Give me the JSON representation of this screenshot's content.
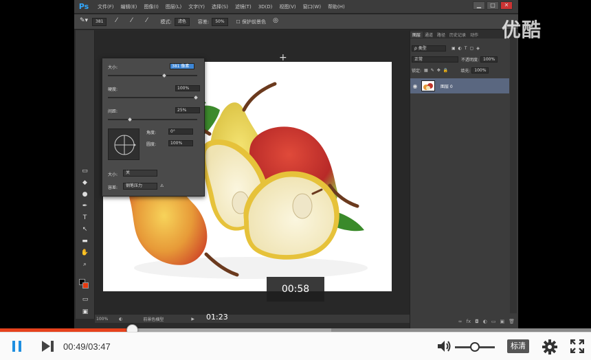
{
  "photoshop": {
    "logo": "Ps",
    "menus": [
      "文件(F)",
      "编辑(E)",
      "图像(I)",
      "图层(L)",
      "文字(Y)",
      "选择(S)",
      "滤镜(T)",
      "3D(D)",
      "视图(V)",
      "窗口(W)",
      "帮助(H)"
    ],
    "window_buttons": [
      "▁",
      "□",
      "✕"
    ],
    "options_bar": {
      "brush_size": "381",
      "mode_label": "模式:",
      "mode_value": "滤色",
      "opacity_label": "容差:",
      "opacity_value": "50%",
      "protect_label": "保护前景色"
    },
    "brush_panel": {
      "size_label": "大小:",
      "size_value": "381 像素",
      "hardness_label": "硬度:",
      "hardness_value": "100%",
      "spacing_label": "间距:",
      "spacing_value": "25%",
      "angle_label": "角度:",
      "angle_value": "0°",
      "roundness_label": "圆度:",
      "roundness_value": "100%",
      "size_control_label": "大小:",
      "size_control_value": "关",
      "tolerance_label": "容差:",
      "tolerance_value": "钢笔压力"
    },
    "status": {
      "zoom": "100%",
      "info": "前景色横型"
    },
    "layers_panel": {
      "tabs": [
        "图层",
        "通道",
        "路径",
        "历史记录",
        "动作"
      ],
      "kind_label": "ρ 类型",
      "blend_mode": "正常",
      "opacity_label": "不透明度:",
      "opacity_value": "100%",
      "lock_label": "锁定:",
      "fill_label": "填充:",
      "fill_value": "100%",
      "layer_name": "图层 0"
    }
  },
  "watermark": "优酷",
  "preview_time": "00:58",
  "hover_time": "01:23",
  "player": {
    "current_time": "00:49",
    "separator": "/",
    "total_time": "03:47",
    "quality": "标清",
    "played_fraction": 0.223,
    "buffered_fraction": 0.56,
    "volume_fraction": 0.5
  },
  "colors": {
    "accent": "#e6421d",
    "player_icon": "#1f8fe0",
    "ps_bg": "#2b2b2b"
  },
  "icons": [
    "pause-icon",
    "next-icon",
    "volume-icon",
    "settings-icon",
    "fullscreen-icon"
  ]
}
